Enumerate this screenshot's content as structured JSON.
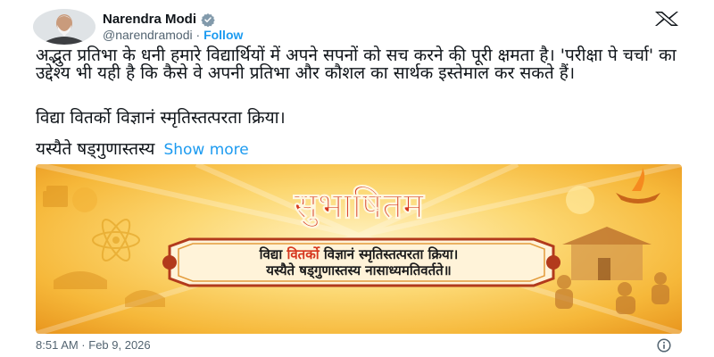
{
  "author": {
    "name": "Narendra Modi",
    "handle": "@narendramodi",
    "separator": "·",
    "follow_label": "Follow"
  },
  "tweet": {
    "paragraph1": "अद्भुत प्रतिभा के धनी हमारे विद्यार्थियों में अपने सपनों को सच करने की पूरी क्षमता है। 'परीक्षा पे चर्चा' का उद्देश्य भी यही है कि कैसे वे अपनी प्रतिभा और कौशल का सार्थक इस्तेमाल कर सकते हैं।",
    "paragraph2": "विद्या वितर्को विज्ञानं स्मृतिस्तत्परता क्रिया।",
    "paragraph3": "यस्यैते षड्गुणास्तस्य",
    "show_more": "Show more"
  },
  "media": {
    "title": "सुभाषितम",
    "line1_part1": "विद्या ",
    "line1_highlight": "वितर्को",
    "line1_part2": " विज्ञानं स्मृतिस्तत्परता क्रिया।",
    "line2": "यस्यैते षड्गुणास्तस्य नासाध्यमतिवर्तते॥"
  },
  "footer": {
    "timestamp": "8:51 AM · Feb 9, 2026"
  },
  "colors": {
    "link": "#1d9bf0",
    "title_red": "#d6361e",
    "scroll_border": "#b23a1c",
    "verified": "#829aab"
  },
  "icons": [
    "verified-badge-icon",
    "x-logo-icon",
    "info-icon"
  ]
}
